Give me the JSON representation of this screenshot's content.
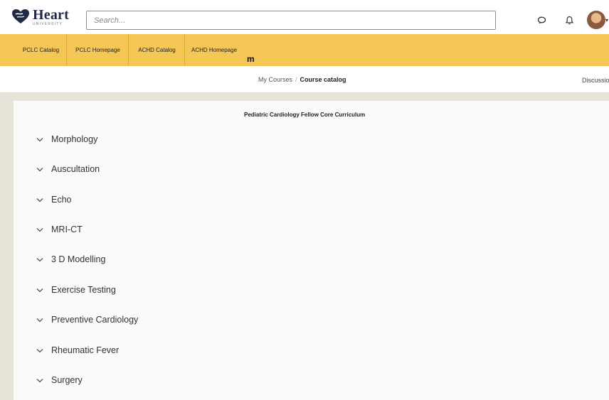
{
  "header": {
    "logo_word": "Heart",
    "logo_sub": "UNIVERSITY",
    "search_placeholder": "Search..."
  },
  "nav": {
    "items": [
      {
        "label": "PCLC Catalog"
      },
      {
        "label": "PCLC Homepage"
      },
      {
        "label": "ACHD Catalog"
      },
      {
        "label": "ACHD Homepage"
      }
    ],
    "stray_text": "m"
  },
  "breadcrumb": {
    "items": [
      "My Courses",
      "Course catalog"
    ],
    "separator": "/",
    "right_link": "Discussio"
  },
  "main": {
    "course_title": "Pediatric Cardiology Fellow Core Curriculum",
    "categories": [
      {
        "label": "Morphology"
      },
      {
        "label": "Auscultation"
      },
      {
        "label": "Echo"
      },
      {
        "label": "MRI-CT"
      },
      {
        "label": "3 D Modelling"
      },
      {
        "label": "Exercise Testing"
      },
      {
        "label": "Preventive Cardiology"
      },
      {
        "label": "Rheumatic Fever"
      },
      {
        "label": "Surgery"
      }
    ]
  },
  "colors": {
    "nav_bar": "#f4c654",
    "frame": "#e8e3d8",
    "panel": "#fafafa",
    "logo": "#1f2a44"
  },
  "icons": {
    "logo": "heart-logo-icon",
    "messages": "chat-bubble-icon",
    "notifications": "bell-icon",
    "expand": "chevron-down-icon"
  }
}
